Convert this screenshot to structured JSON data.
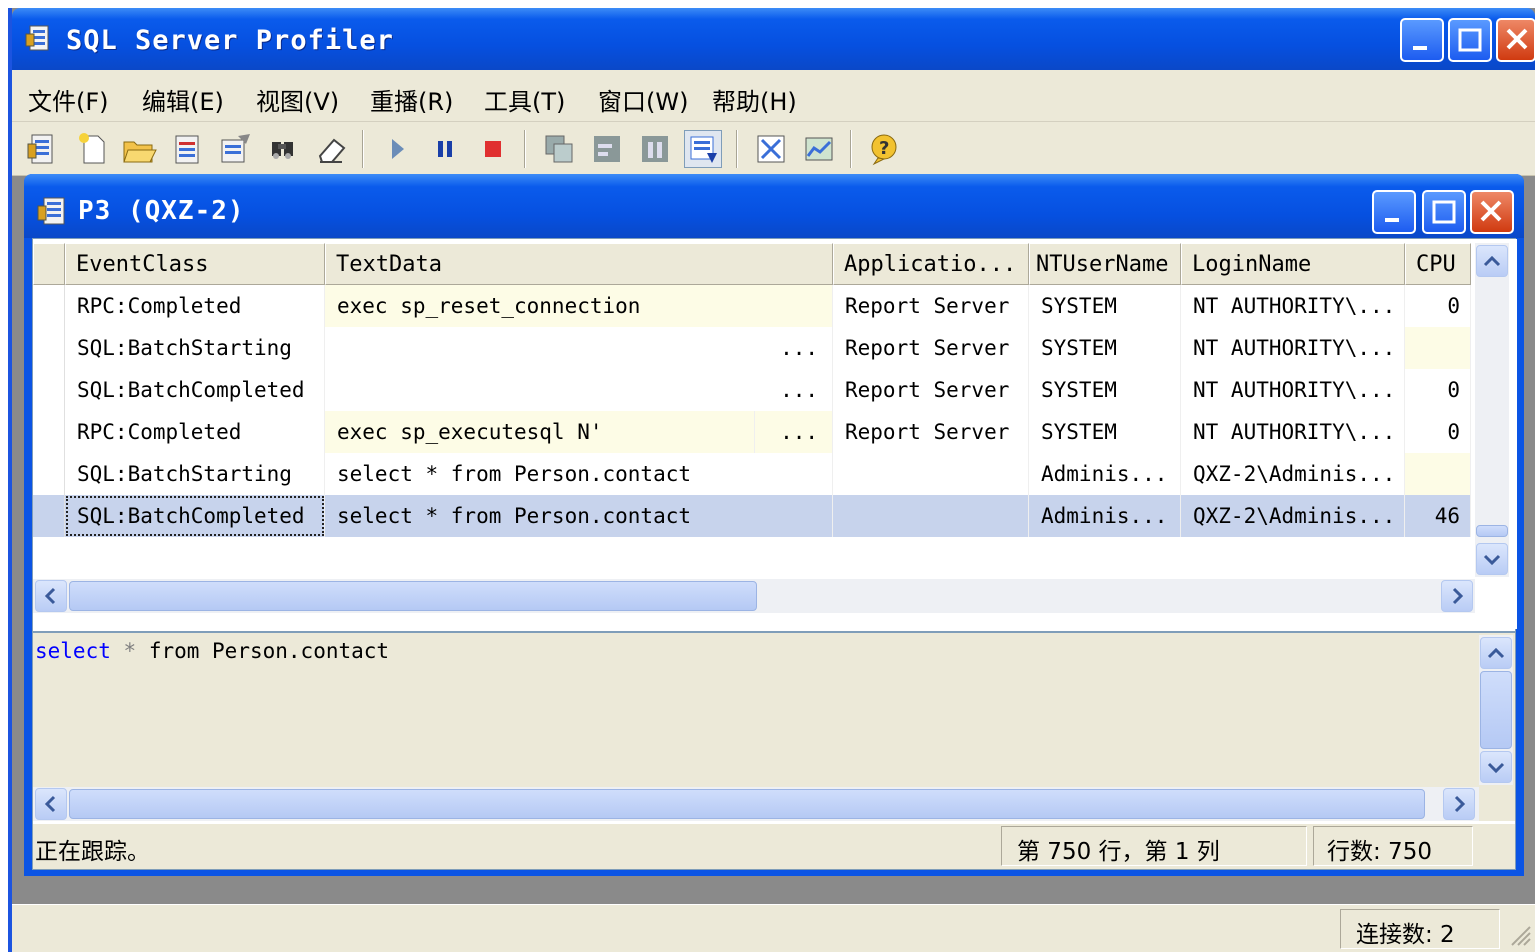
{
  "app": {
    "title": "SQL Server Profiler",
    "icon": "profiler-icon"
  },
  "menu": [
    "文件(F)",
    "编辑(E)",
    "视图(V)",
    "重播(R)",
    "工具(T)",
    "窗口(W)",
    "帮助(H)"
  ],
  "toolbar": {
    "buttons": [
      "properties-icon",
      "new-trace-icon",
      "open-icon",
      "save-icon",
      "template-icon",
      "find-icon",
      "clear-icon",
      "run-icon",
      "pause-icon",
      "stop-icon",
      "replay-icon",
      "step-icon",
      "breakpoint-icon",
      "auto-scroll-icon",
      "options-icon",
      "perfmon-icon",
      "help-icon"
    ]
  },
  "trace_window": {
    "title": "P3 (QXZ-2)",
    "columns": [
      "EventClass",
      "TextData",
      "Applicatio...",
      "NTUserName",
      "LoginName",
      "CPU"
    ],
    "rows": [
      {
        "event": "RPC:Completed",
        "text": "exec sp_reset_connection",
        "text_more": "",
        "app": "Report Server",
        "ntuser": "SYSTEM",
        "login": "NT AUTHORITY\\...",
        "cpu": "0"
      },
      {
        "event": "SQL:BatchStarting",
        "text": "",
        "text_more": "...",
        "app": "Report Server",
        "ntuser": "SYSTEM",
        "login": "NT AUTHORITY\\...",
        "cpu": ""
      },
      {
        "event": "SQL:BatchCompleted",
        "text": "",
        "text_more": "...",
        "app": "Report Server",
        "ntuser": "SYSTEM",
        "login": "NT AUTHORITY\\...",
        "cpu": "0"
      },
      {
        "event": "RPC:Completed",
        "text": "exec sp_executesql N'",
        "text_more": "...",
        "app": "Report Server",
        "ntuser": "SYSTEM",
        "login": "NT AUTHORITY\\...",
        "cpu": "0"
      },
      {
        "event": "SQL:BatchStarting",
        "text": "select * from Person.contact",
        "text_more": "",
        "app": "",
        "ntuser": "Adminis...",
        "login": "QXZ-2\\Adminis...",
        "cpu": ""
      },
      {
        "event": "SQL:BatchCompleted",
        "text": "select * from Person.contact",
        "text_more": "",
        "app": "",
        "ntuser": "Adminis...",
        "login": "QXZ-2\\Adminis...",
        "cpu": "46"
      }
    ],
    "selected_row": 5,
    "sql": {
      "keyword": "select",
      "star": "*",
      "rest": "from Person.contact"
    },
    "status": {
      "message": "正在跟踪。",
      "position": "第 750 行，第 1 列",
      "row_count": "行数: 750"
    }
  },
  "app_status": {
    "connections": "连接数: 2"
  }
}
